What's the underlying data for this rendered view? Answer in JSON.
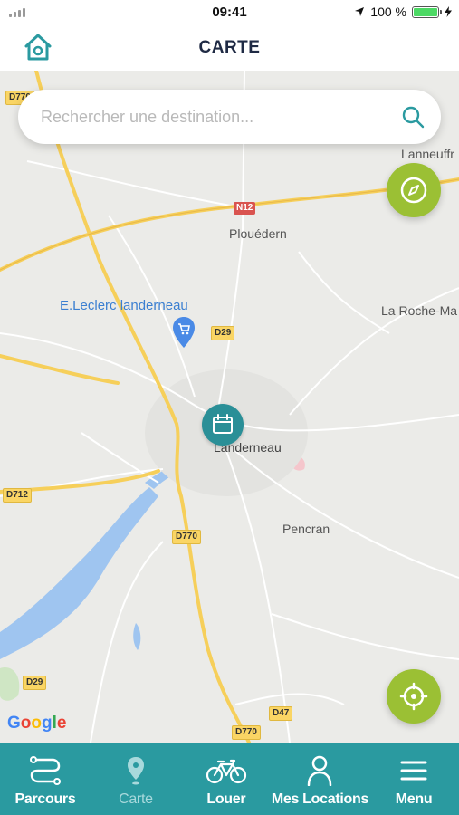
{
  "status_bar": {
    "time": "09:41",
    "battery": "100 %"
  },
  "nav": {
    "title": "CARTE"
  },
  "search": {
    "placeholder": "Rechercher une destination..."
  },
  "map": {
    "places": [
      "Lanneuffr",
      "Plouédern",
      "La Roche-Ma",
      "Landerneau",
      "Pencran"
    ],
    "poi": "E.Leclerc landerneau",
    "roads": [
      "D770",
      "N12",
      "D29",
      "D712",
      "D770",
      "D29",
      "D770",
      "D47"
    ],
    "attribution": [
      "G",
      "o",
      "o",
      "g",
      "l",
      "e"
    ]
  },
  "tabs": [
    {
      "label": "Parcours",
      "icon": "route-icon"
    },
    {
      "label": "Carte",
      "icon": "map-pin-icon",
      "active": true
    },
    {
      "label": "Louer",
      "icon": "bicycle-icon"
    },
    {
      "label": "Mes Locations",
      "icon": "user-icon"
    },
    {
      "label": "Menu",
      "icon": "menu-icon"
    }
  ],
  "colors": {
    "accent": "#2a9aa0",
    "fab": "#9bc034",
    "title": "#1f2a44"
  }
}
